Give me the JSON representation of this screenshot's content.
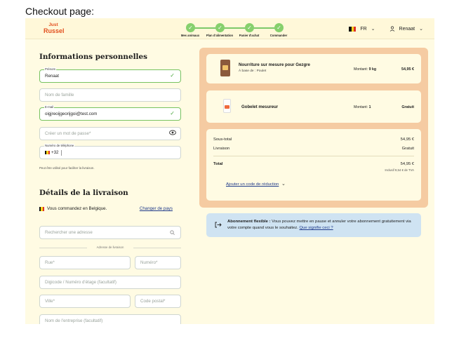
{
  "caption": "Checkout page:",
  "brand": {
    "line1": "Just",
    "line2": "Russel",
    "color": "#e24f1e"
  },
  "steps": [
    {
      "label": "Mes animaux"
    },
    {
      "label": "Plan d'alimentation"
    },
    {
      "label": "Panier d'achat"
    },
    {
      "label": "Commander"
    }
  ],
  "header": {
    "lang": "FR",
    "user": "Renaat",
    "user_icon": "user-icon",
    "flag": "belgium-flag"
  },
  "personal": {
    "title": "Informations personnelles",
    "first_name": {
      "label": "Prénom",
      "value": "Renaat"
    },
    "last_name": {
      "placeholder": "Nom de famille"
    },
    "email": {
      "label": "E-mail",
      "value": "oigjreoijgeorijgoi@test.com"
    },
    "password": {
      "placeholder": "Créer un mot de passe*"
    },
    "phone": {
      "label": "Numéro de téléphone",
      "prefix": "+32"
    },
    "note": "Peut être utilisé pour faciliter la livraison."
  },
  "delivery": {
    "title": "Détails de la livraison",
    "country_text": "Vous commandez en Belgique.",
    "change_country": "Changer de pays",
    "search_placeholder": "Rechercher une adresse",
    "divider": "Adresse de livraison",
    "street": "Rue*",
    "number": "Numéro*",
    "digicode": "Digicode / Numéro d'étage (facultatif)",
    "city": "Ville*",
    "postal": "Code postal*",
    "company": "Nom de l'entreprise (facultatif)"
  },
  "cart": {
    "items": [
      {
        "name": "Nourriture sur mesure pour Gezgre",
        "sub": "À base de : Poulet",
        "amount_label": "Montant:",
        "amount": "9 kg",
        "price": "54,95 €"
      },
      {
        "name": "Gobelet mesureur",
        "amount_label": "Montant:",
        "amount": "1",
        "price": "Gratuit"
      }
    ],
    "subtotal_label": "Sous-total",
    "subtotal": "54,95 €",
    "delivery_label": "Livraison",
    "delivery": "Gratuit",
    "total_label": "Total",
    "total": "54,95 €",
    "vat": "Inclusif 9,54 € de TVA",
    "discount": "Ajouter un code de réduction"
  },
  "info": {
    "bold": "Abonnement flexible :",
    "text": " Vous pouvez mettre en pause et annuler votre abonnement gratuitement via votre compte quand vous le souhaitez. ",
    "link": "Que signifie ceci ?"
  },
  "colors": {
    "panel": "#f5cba2",
    "card": "#fffbe3",
    "info": "#cfe3f2",
    "success": "#86d06c",
    "page": "#fffbe3"
  }
}
